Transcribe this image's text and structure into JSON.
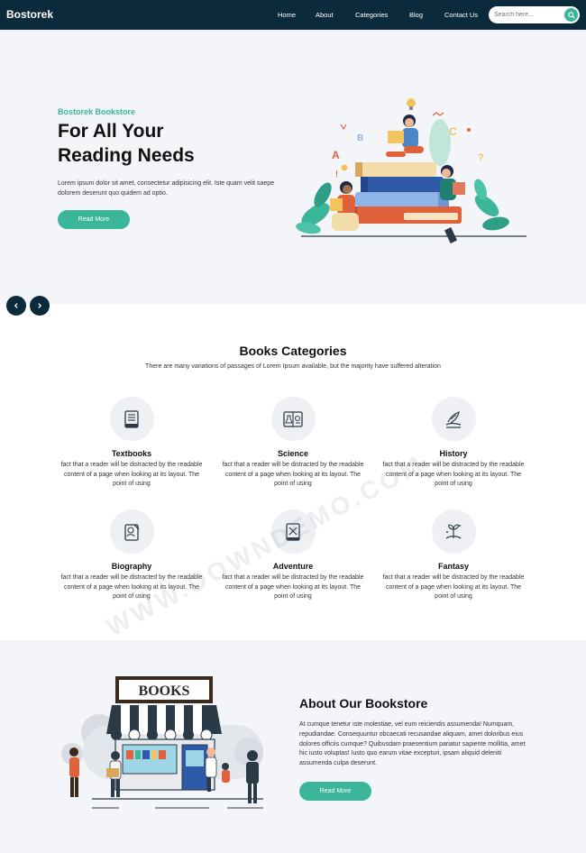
{
  "nav": {
    "brand": "Bostorek",
    "items": [
      {
        "label": "Home"
      },
      {
        "label": "About"
      },
      {
        "label": "Categories"
      },
      {
        "label": "Blog"
      },
      {
        "label": "Contact Us"
      }
    ],
    "search_placeholder": "Search here..."
  },
  "hero": {
    "subtitle": "Bostorek Bookstore",
    "title_line1": "For All Your",
    "title_line2": "Reading Needs",
    "text": "Lorem ipsum dolor sit amet, consectetur adipisicing elit. Iste quam velit saepe dolorem deserunt quo quidem ad optio.",
    "button": "Read More",
    "prev_icon": "chevron-left-icon",
    "next_icon": "chevron-right-icon"
  },
  "categories": {
    "heading": "Books Categories",
    "description": "There are many variations of passages of Lorem Ipsum available, but the majority have suffered alteration",
    "items": [
      {
        "name": "Textbooks",
        "icon": "textbook-icon",
        "text": "fact that a reader will be distracted by the readable content of a page when looking at its layout. The point of using"
      },
      {
        "name": "Science",
        "icon": "science-icon",
        "text": "fact that a reader will be distracted by the readable content of a page when looking at its layout. The point of using"
      },
      {
        "name": "History",
        "icon": "history-icon",
        "text": "fact that a reader will be distracted by the readable content of a page when looking at its layout. The point of using"
      },
      {
        "name": "Biography",
        "icon": "biography-icon",
        "text": "fact that a reader will be distracted by the readable content of a page when looking at its layout. The point of using"
      },
      {
        "name": "Adventure",
        "icon": "adventure-icon",
        "text": "fact that a reader will be distracted by the readable content of a page when looking at its layout. The point of using"
      },
      {
        "name": "Fantasy",
        "icon": "fantasy-icon",
        "text": "fact that a reader will be distracted by the readable content of a page when looking at its layout. The point of using"
      }
    ]
  },
  "about": {
    "title": "About Our Bookstore",
    "text": "At cumque tenetur iste molestiae, vel eum reiciendis assumenda! Numquam, repudiandae. Consequuntur obcaecati recusandae aliquam, amet doloribus eius dolores officiis cumque? Quibusdam praesentium pariatur sapiente mollitia, amet hic iusto voluptas! Iusto quo earum vitae excepturi, ipsam aliquid deleniti assumenda culpa deserunt.",
    "button": "Read More",
    "store_sign": "BOOKS"
  },
  "watermark": "WWW.DOWNDEMO.COM",
  "colors": {
    "nav_bg": "#0b2b3c",
    "accent": "#3bb69a",
    "section_bg": "#f3f5f9"
  }
}
